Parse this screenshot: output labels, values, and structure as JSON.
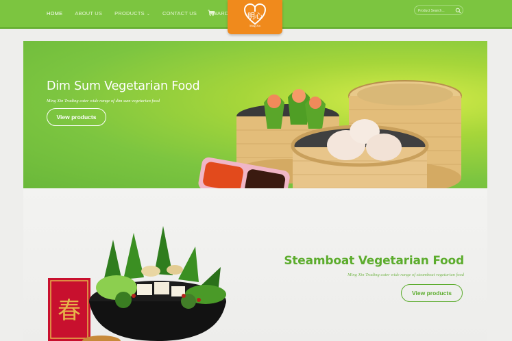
{
  "nav": {
    "items": [
      {
        "label": "HOME",
        "active": true
      },
      {
        "label": "ABOUT US",
        "active": false
      },
      {
        "label": "PRODUCTS",
        "active": false,
        "has_dropdown": true
      },
      {
        "label": "CONTACT US",
        "active": false
      },
      {
        "label": "AWARDS",
        "active": false
      }
    ],
    "cart_icon": "shopping-cart-icon",
    "dropdown_icon": "chevron-down-icon"
  },
  "logo": {
    "glyphs": "明心",
    "caption": "Ming Xin"
  },
  "search": {
    "placeholder": "Product Search...",
    "icon": "search-icon"
  },
  "banners": [
    {
      "title": "Dim Sum Vegetarian Food",
      "subtitle": "Ming Xin Trading cater wide range of dim sum vegetarian food",
      "button": "View products"
    },
    {
      "title": "Steamboat Vegetarian Food",
      "subtitle": "Ming Xin Trading cater wide range of steamboat vegetarian food",
      "button": "View products"
    }
  ],
  "decor": {
    "spring_glyph": "春"
  },
  "colors": {
    "brand_green": "#7cc540",
    "title_green": "#5cac2d",
    "logo_orange": "#f08a1c"
  }
}
